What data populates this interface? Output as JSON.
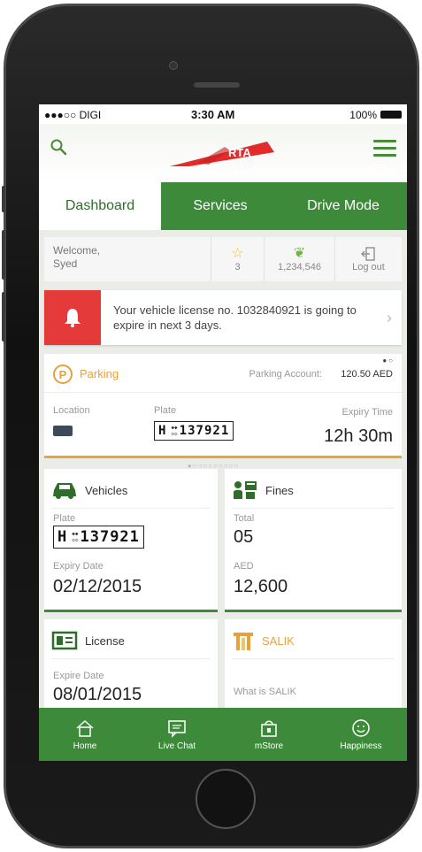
{
  "status_bar": {
    "carrier": "●●●○○ DIGI",
    "time": "3:30 AM",
    "battery": "100%"
  },
  "header": {
    "logo_text": "RTA",
    "search_icon": "search-icon",
    "menu_icon": "hamburger-menu-icon"
  },
  "tabs": [
    {
      "label": "Dashboard",
      "active": true
    },
    {
      "label": "Services",
      "active": false
    },
    {
      "label": "Drive Mode",
      "active": false
    }
  ],
  "welcome": {
    "greeting": "Welcome,",
    "name": "Syed",
    "favorites_count": "3",
    "points": "1,234,546",
    "logout_label": "Log out"
  },
  "alert": {
    "message": "Your vehicle license no. 1032840921 is going to expire in next 3 days."
  },
  "parking": {
    "title": "Parking",
    "account_label": "Parking Account:",
    "account_value": "120.50 AED",
    "location_label": "Location",
    "plate_label": "Plate",
    "plate_letter": "H",
    "plate_number": "137921",
    "expiry_label": "Expiry Time",
    "expiry_value": "12h 30m"
  },
  "vehicles": {
    "title": "Vehicles",
    "plate_label": "Plate",
    "plate_letter": "H",
    "plate_number": "137921",
    "expiry_label": "Expiry Date",
    "expiry_value": "02/12/2015"
  },
  "fines": {
    "title": "Fines",
    "total_label": "Total",
    "total_value": "05",
    "aed_label": "AED",
    "aed_value": "12,600"
  },
  "license": {
    "title": "License",
    "expire_label": "Expire Date",
    "expire_value": "08/01/2015"
  },
  "salik": {
    "title": "SALIK",
    "what_is_label": "What is SALIK"
  },
  "bottom_nav": [
    {
      "label": "Home",
      "icon": "home-icon"
    },
    {
      "label": "Live Chat",
      "icon": "chat-icon"
    },
    {
      "label": "mStore",
      "icon": "store-icon"
    },
    {
      "label": "Happiness",
      "icon": "smiley-icon"
    }
  ],
  "colors": {
    "brand_green": "#3c8a3a",
    "alert_red": "#e53a3a",
    "parking_orange": "#e8a13a"
  }
}
